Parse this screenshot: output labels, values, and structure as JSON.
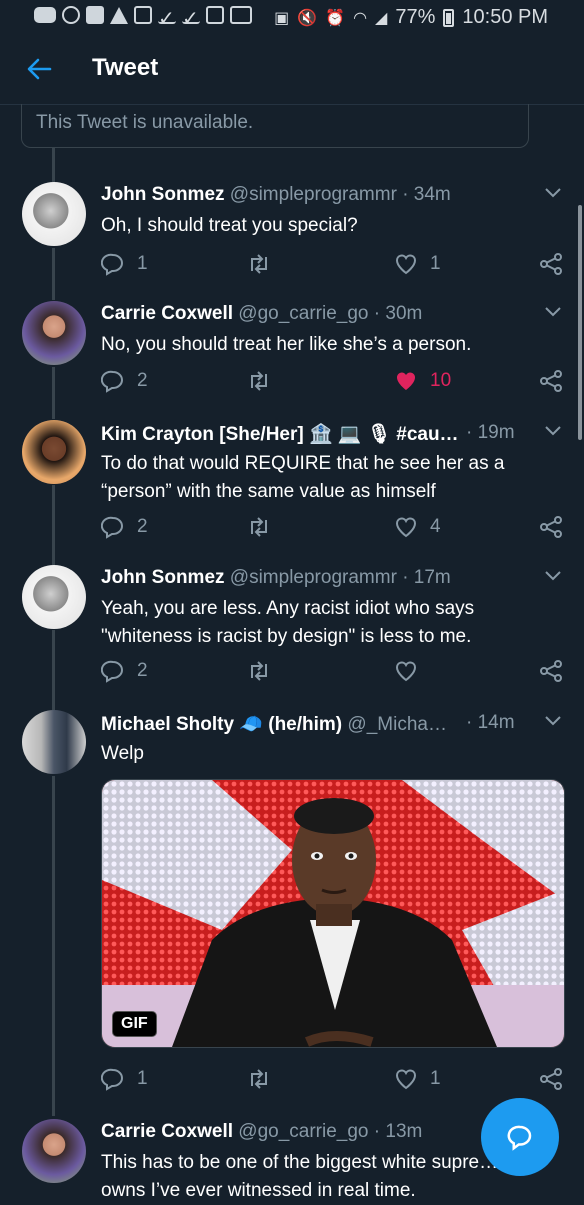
{
  "status_bar": {
    "battery": "77%",
    "time": "10:50 PM"
  },
  "header": {
    "back_icon": "arrow-left-icon",
    "title": "Tweet"
  },
  "unavailable_notice": "This Tweet is unavailable.",
  "tweets": [
    {
      "name": "John Sonmez",
      "handle": "@simpleprogrammr",
      "time": "· 34m",
      "text": "Oh, I should treat you special?",
      "replies": "1",
      "retweets": "",
      "likes": "1",
      "liked": false
    },
    {
      "name": "Carrie Coxwell",
      "handle": "@go_carrie_go",
      "time": "· 30m",
      "text": "No, you should treat her like she’s a person.",
      "replies": "2",
      "retweets": "",
      "likes": "10",
      "liked": true
    },
    {
      "name": "Kim Crayton [She/Her] 🏦 💻 🎙 #cau…",
      "handle": "",
      "time": "· 19m",
      "text": "To do that would REQUIRE that he see her as a “person” with the same value as himself",
      "replies": "2",
      "retweets": "",
      "likes": "4",
      "liked": false
    },
    {
      "name": "John Sonmez",
      "handle": "@simpleprogrammr",
      "time": "· 17m",
      "text": "Yeah, you are less. Any racist idiot who says \"whiteness is racist by design\" is less to me.",
      "replies": "2",
      "retweets": "",
      "likes": "",
      "liked": false
    },
    {
      "name": "Michael Sholty 🧢 (he/him)",
      "handle": "@_Micha…",
      "time": "· 14m",
      "text": "Welp",
      "replies": "1",
      "retweets": "",
      "likes": "1",
      "liked": false,
      "media_badge": "GIF"
    },
    {
      "name": "Carrie Coxwell",
      "handle": "@go_carrie_go",
      "time": "· 13m",
      "text": "This has to be one of the biggest white supre… self-owns I’ve ever witnessed in real time.",
      "replies": "",
      "retweets": "",
      "likes": "",
      "liked": false
    }
  ],
  "colors": {
    "background": "#15202b",
    "accent": "#1d9bf0",
    "like": "#e0245e",
    "muted": "#8899a6"
  },
  "fab_icon": "compose-reply-icon"
}
